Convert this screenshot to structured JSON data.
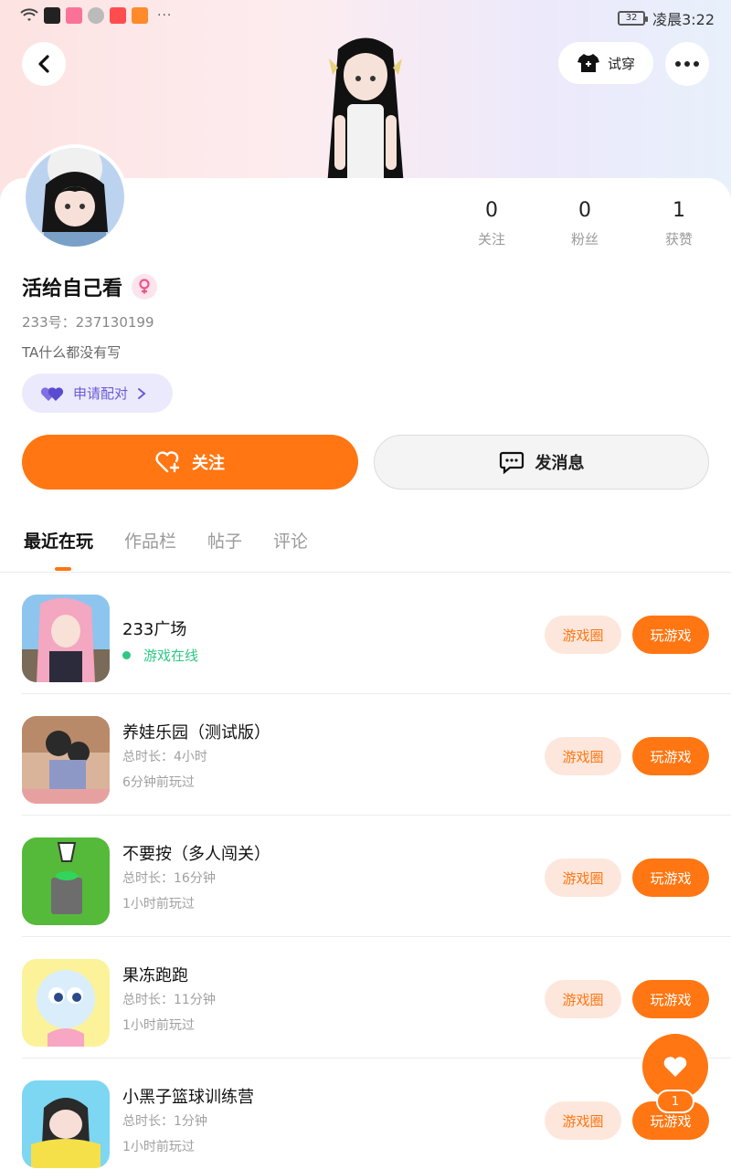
{
  "status_bar": {
    "time": "凌晨3:22",
    "battery": "32",
    "more": "···"
  },
  "header": {
    "tryon_label": "试穿"
  },
  "profile": {
    "username": "活给自己看",
    "uid": "233号：237130199",
    "bio": "TA什么都没有写",
    "pair_label": "申请配对",
    "stats": [
      {
        "value": "0",
        "label": "关注"
      },
      {
        "value": "0",
        "label": "粉丝"
      },
      {
        "value": "1",
        "label": "获赞"
      }
    ]
  },
  "actions": {
    "follow_label": "关注",
    "message_label": "发消息"
  },
  "tabs": [
    "最近在玩",
    "作品栏",
    "帖子",
    "评论"
  ],
  "games": [
    {
      "title": "233广场",
      "status": "游戏在线",
      "circle": "游戏圈",
      "play": "玩游戏"
    },
    {
      "title": "养娃乐园（测试版）",
      "duration": "总时长：4小时",
      "last_played": "6分钟前玩过",
      "circle": "游戏圈",
      "play": "玩游戏"
    },
    {
      "title": "不要按（多人闯关）",
      "duration": "总时长：16分钟",
      "last_played": "1小时前玩过",
      "circle": "游戏圈",
      "play": "玩游戏"
    },
    {
      "title": "果冻跑跑",
      "duration": "总时长：11分钟",
      "last_played": "1小时前玩过",
      "circle": "游戏圈",
      "play": "玩游戏"
    },
    {
      "title": "小黑子篮球训练营",
      "duration": "总时长：1分钟",
      "last_played": "1小时前玩过",
      "circle": "游戏圈",
      "play": "玩游戏"
    }
  ],
  "float": {
    "count": "1"
  },
  "colors": {
    "accent": "#ff7612",
    "online": "#2fc784",
    "pair": "#6a5bd6"
  }
}
